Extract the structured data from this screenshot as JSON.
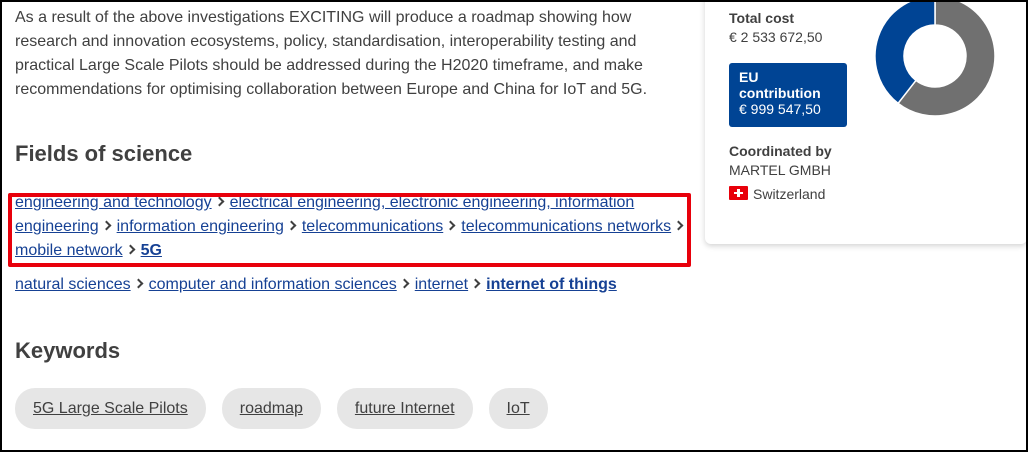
{
  "intro_text": "As a result of the above investigations EXCITING will produce a roadmap showing how research and innovation ecosystems, policy, standardisation, interoperability testing and practical Large Scale Pilots should be addressed during the H2020 timeframe, and make recommendations for optimising collaboration between Europe and China for IoT and 5G.",
  "fields_heading": "Fields of science",
  "fields": [
    {
      "items": [
        "engineering and technology",
        "electrical engineering, electronic engineering, information engineering",
        "information engineering",
        "telecommunications",
        "telecommunications networks",
        "mobile network",
        "5G"
      ]
    },
    {
      "items": [
        "natural sciences",
        "computer and information sciences",
        "internet",
        "internet of things"
      ]
    }
  ],
  "keywords_heading": "Keywords",
  "keywords": [
    "5G Large Scale Pilots",
    "roadmap",
    "future Internet",
    "IoT"
  ],
  "funding": {
    "total_cost_label": "Total cost",
    "total_cost_value": "€ 2 533 672,50",
    "eu_contribution_label": "EU contribution",
    "eu_contribution_value": "€ 999 547,50",
    "eu_share_fraction": 0.3945,
    "colors": {
      "eu": "#004494",
      "rest": "#707070"
    }
  },
  "coordinator": {
    "label": "Coordinated by",
    "name": "MARTEL GMBH",
    "country": "Switzerland",
    "flag_icon": "swiss-flag-icon"
  },
  "highlight_color": "#e8000b"
}
